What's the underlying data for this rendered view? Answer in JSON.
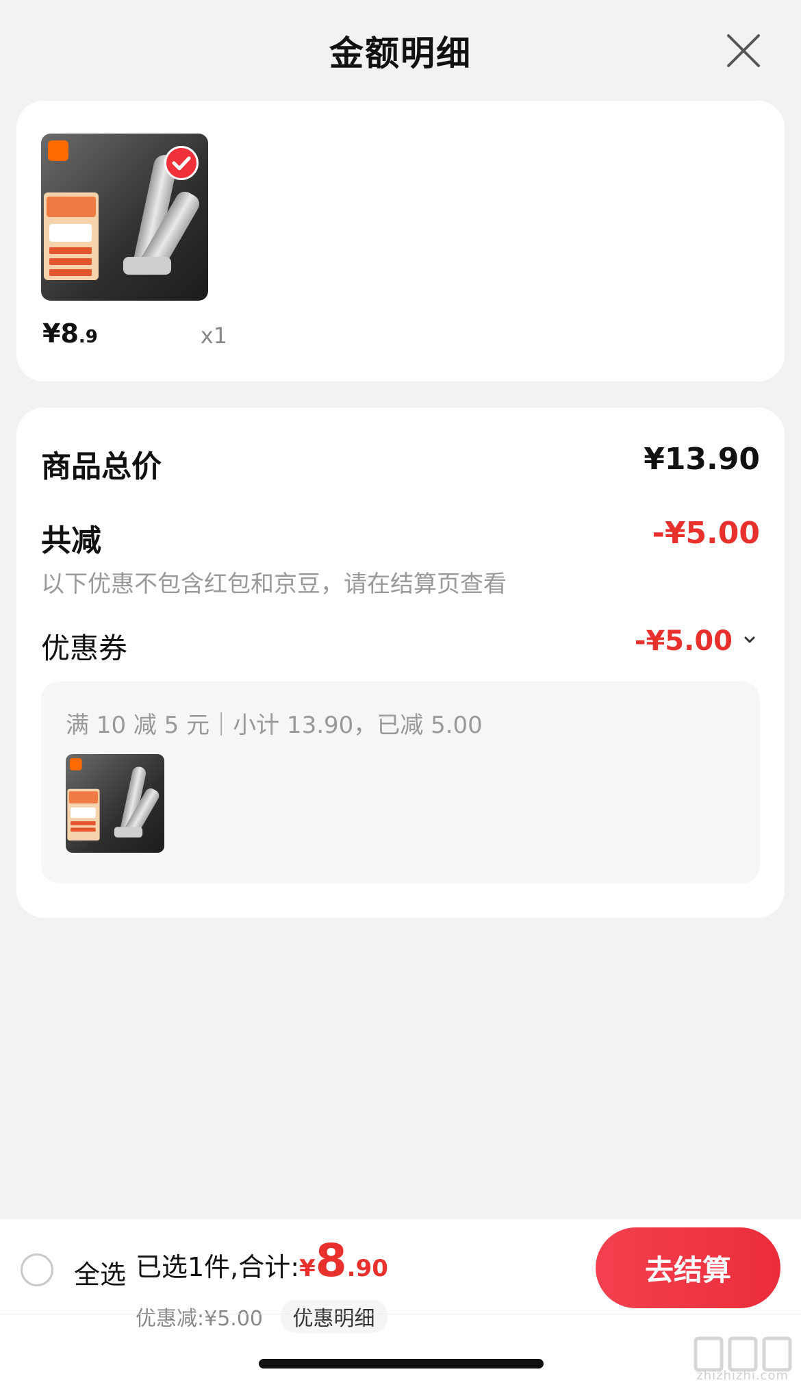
{
  "header": {
    "title": "金额明细"
  },
  "product": {
    "price_int": "¥8",
    "price_dec": ".9",
    "quantity": "x1",
    "thumb_lines": [
      "米家防飞溅",
      "指甲刀",
      "全国八仓速发",
      "￥13.9",
      "防飞溅收纳盒盖",
      "拖板磨砂质感",
      "商品级420不锈钢"
    ],
    "brand_badge": "MI"
  },
  "summary": {
    "total_label": "商品总价",
    "total_value": "¥13.90",
    "reduce_label": "共减",
    "reduce_value": "-¥5.00",
    "hint": "以下优惠不包含红包和京豆，请在结算页查看",
    "coupon_label": "优惠券",
    "coupon_value": "-¥5.00",
    "coupon_detail": "满 10 减 5 元｜小计 13.90，已减 5.00"
  },
  "footer": {
    "select_all": "全选",
    "selected_label": "已选1件,合计:",
    "total_sym": "¥",
    "total_int": "8",
    "total_dec": ".90",
    "discount": "优惠减:¥5.00",
    "detail_link": "优惠明细",
    "checkout": "去结算"
  },
  "watermark": {
    "text": "zhizhizhi.com"
  },
  "colors": {
    "accent": "#e8302d",
    "button": "#ee3340",
    "background": "#f2f2f2"
  }
}
